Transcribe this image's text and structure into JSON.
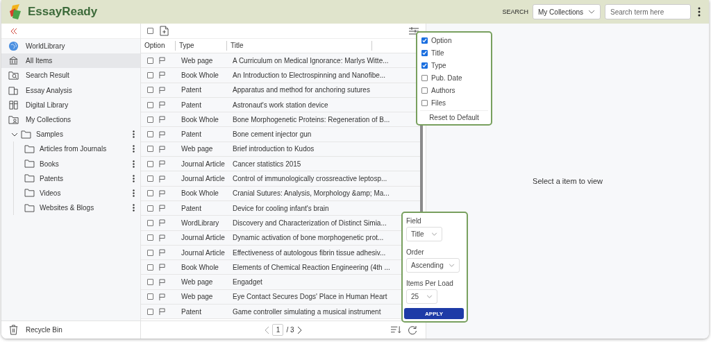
{
  "header": {
    "logo": "EssayReady",
    "search_label": "SEARCH",
    "scope": "My Collections",
    "search": {
      "placeholder": "Search term here"
    }
  },
  "sidebar": {
    "items": [
      {
        "label": "WorldLibrary",
        "selected": false
      },
      {
        "label": "All Items",
        "selected": true
      },
      {
        "label": "Search Result",
        "selected": false
      },
      {
        "label": "Essay Analysis",
        "selected": false
      },
      {
        "label": "Digital Library",
        "selected": false
      },
      {
        "label": "My Collections",
        "selected": false
      }
    ],
    "tree": [
      {
        "label": "Samples",
        "expanded": true,
        "children": [
          {
            "label": "Articles from Journals"
          },
          {
            "label": "Books"
          },
          {
            "label": "Patents"
          },
          {
            "label": "Videos"
          },
          {
            "label": "Websites & Blogs"
          }
        ]
      }
    ],
    "footer": "Recycle Bin"
  },
  "table": {
    "select_all_checked": false,
    "columns": [
      "Option",
      "Type",
      "Title"
    ],
    "rows": [
      {
        "checked": false,
        "type": "Web page",
        "title": "A Curriculum on Medical Ignorance: Marlys Witte..."
      },
      {
        "checked": false,
        "type": "Book Whole",
        "title": "An Introduction to Electrospinning and Nanofibe..."
      },
      {
        "checked": false,
        "type": "Patent",
        "title": "Apparatus and method for anchoring sutures"
      },
      {
        "checked": false,
        "type": "Patent",
        "title": "Astronaut's work station device"
      },
      {
        "checked": false,
        "type": "Book Whole",
        "title": "Bone Morphogenetic Proteins: Regeneration of B..."
      },
      {
        "checked": false,
        "type": "Patent",
        "title": "Bone cement injector gun"
      },
      {
        "checked": false,
        "type": "Web page",
        "title": "Brief introduction to Kudos"
      },
      {
        "checked": false,
        "type": "Journal Article",
        "title": "Cancer statistics 2015"
      },
      {
        "checked": false,
        "type": "Journal Article",
        "title": "Control of immunologically crossreactive leptosp..."
      },
      {
        "checked": false,
        "type": "Book Whole",
        "title": "Cranial Sutures: Analysis, Morphology &amp; Ma..."
      },
      {
        "checked": false,
        "type": "Patent",
        "title": "Device for cooling infant's brain"
      },
      {
        "checked": false,
        "type": "WordLibrary",
        "title": "Discovery and Characterization of Distinct Simia..."
      },
      {
        "checked": false,
        "type": "Journal Article",
        "title": "Dynamic activation of bone morphogenetic prot..."
      },
      {
        "checked": false,
        "type": "Journal Article",
        "title": "Effectiveness of autologous fibrin tissue adhesiv..."
      },
      {
        "checked": false,
        "type": "Book Whole",
        "title": "Elements of Chemical Reaction Engineering (4th ..."
      },
      {
        "checked": false,
        "type": "Web page",
        "title": "Engadget"
      },
      {
        "checked": false,
        "type": "Web page",
        "title": "Eye Contact Secures Dogs' Place in Human Heart"
      },
      {
        "checked": false,
        "type": "Patent",
        "title": "Game controller simulating a musical instrument"
      }
    ],
    "pager": {
      "page": "1",
      "total": "/ 3"
    }
  },
  "column_menu": {
    "items": [
      {
        "label": "Option",
        "checked": true
      },
      {
        "label": "Title",
        "checked": true
      },
      {
        "label": "Type",
        "checked": true
      },
      {
        "label": "Pub. Date",
        "checked": false
      },
      {
        "label": "Authors",
        "checked": false
      },
      {
        "label": "Files",
        "checked": false
      }
    ],
    "reset": "Reset to Default"
  },
  "sort_panel": {
    "fields": [
      {
        "label": "Field",
        "value": "Title"
      },
      {
        "label": "Order",
        "value": "Ascending"
      },
      {
        "label": "Items Per Load",
        "value": "25"
      }
    ],
    "apply": "APPLY"
  },
  "detail": {
    "empty_text": "Select a item to view"
  }
}
